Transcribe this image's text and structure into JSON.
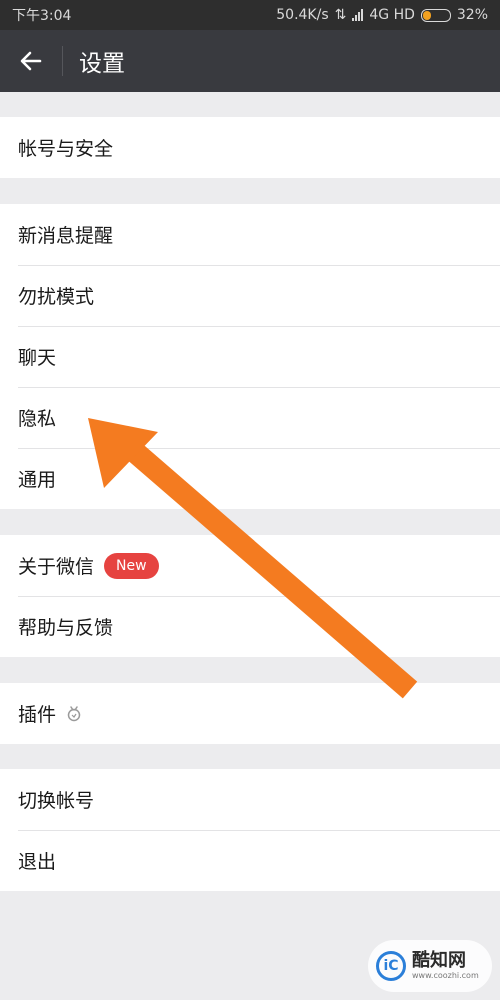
{
  "status_bar": {
    "time": "下午3:04",
    "speed": "50.4K/s",
    "network": "4G HD",
    "battery_percent": "32%",
    "battery_level": 0.32
  },
  "header": {
    "title": "设置",
    "back_icon": "back-arrow-icon"
  },
  "groups": [
    {
      "items": [
        {
          "label": "帐号与安全"
        }
      ]
    },
    {
      "items": [
        {
          "label": "新消息提醒"
        },
        {
          "label": "勿扰模式"
        },
        {
          "label": "聊天"
        },
        {
          "label": "隐私"
        },
        {
          "label": "通用"
        }
      ]
    },
    {
      "items": [
        {
          "label": "关于微信",
          "badge": "New"
        },
        {
          "label": "帮助与反馈"
        }
      ]
    },
    {
      "items": [
        {
          "label": "插件",
          "icon": "plugin-icon"
        }
      ]
    },
    {
      "items": [
        {
          "label": "切换帐号"
        },
        {
          "label": "退出"
        }
      ]
    }
  ],
  "annotation": {
    "arrow_color": "#f47b20"
  },
  "watermark": {
    "name": "酷知网",
    "url": "www.coozhi.com",
    "logo_text": "iC"
  },
  "colors": {
    "header_bg": "#393a3f",
    "badge_bg": "#e64340"
  }
}
